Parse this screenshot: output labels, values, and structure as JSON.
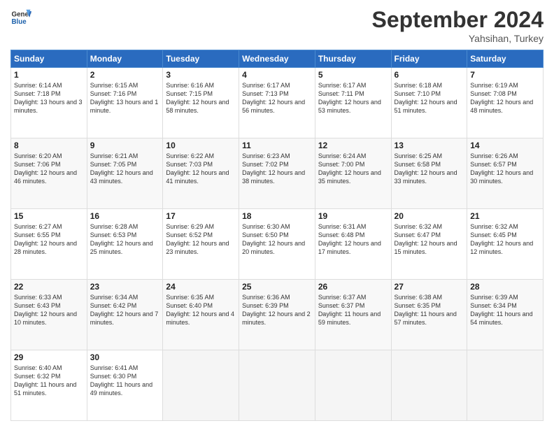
{
  "header": {
    "logo_line1": "General",
    "logo_line2": "Blue",
    "main_title": "September 2024",
    "subtitle": "Yahsihan, Turkey"
  },
  "weekdays": [
    "Sunday",
    "Monday",
    "Tuesday",
    "Wednesday",
    "Thursday",
    "Friday",
    "Saturday"
  ],
  "weeks": [
    [
      {
        "day": "1",
        "sunrise": "Sunrise: 6:14 AM",
        "sunset": "Sunset: 7:18 PM",
        "daylight": "Daylight: 13 hours and 3 minutes."
      },
      {
        "day": "2",
        "sunrise": "Sunrise: 6:15 AM",
        "sunset": "Sunset: 7:16 PM",
        "daylight": "Daylight: 13 hours and 1 minute."
      },
      {
        "day": "3",
        "sunrise": "Sunrise: 6:16 AM",
        "sunset": "Sunset: 7:15 PM",
        "daylight": "Daylight: 12 hours and 58 minutes."
      },
      {
        "day": "4",
        "sunrise": "Sunrise: 6:17 AM",
        "sunset": "Sunset: 7:13 PM",
        "daylight": "Daylight: 12 hours and 56 minutes."
      },
      {
        "day": "5",
        "sunrise": "Sunrise: 6:17 AM",
        "sunset": "Sunset: 7:11 PM",
        "daylight": "Daylight: 12 hours and 53 minutes."
      },
      {
        "day": "6",
        "sunrise": "Sunrise: 6:18 AM",
        "sunset": "Sunset: 7:10 PM",
        "daylight": "Daylight: 12 hours and 51 minutes."
      },
      {
        "day": "7",
        "sunrise": "Sunrise: 6:19 AM",
        "sunset": "Sunset: 7:08 PM",
        "daylight": "Daylight: 12 hours and 48 minutes."
      }
    ],
    [
      {
        "day": "8",
        "sunrise": "Sunrise: 6:20 AM",
        "sunset": "Sunset: 7:06 PM",
        "daylight": "Daylight: 12 hours and 46 minutes."
      },
      {
        "day": "9",
        "sunrise": "Sunrise: 6:21 AM",
        "sunset": "Sunset: 7:05 PM",
        "daylight": "Daylight: 12 hours and 43 minutes."
      },
      {
        "day": "10",
        "sunrise": "Sunrise: 6:22 AM",
        "sunset": "Sunset: 7:03 PM",
        "daylight": "Daylight: 12 hours and 41 minutes."
      },
      {
        "day": "11",
        "sunrise": "Sunrise: 6:23 AM",
        "sunset": "Sunset: 7:02 PM",
        "daylight": "Daylight: 12 hours and 38 minutes."
      },
      {
        "day": "12",
        "sunrise": "Sunrise: 6:24 AM",
        "sunset": "Sunset: 7:00 PM",
        "daylight": "Daylight: 12 hours and 35 minutes."
      },
      {
        "day": "13",
        "sunrise": "Sunrise: 6:25 AM",
        "sunset": "Sunset: 6:58 PM",
        "daylight": "Daylight: 12 hours and 33 minutes."
      },
      {
        "day": "14",
        "sunrise": "Sunrise: 6:26 AM",
        "sunset": "Sunset: 6:57 PM",
        "daylight": "Daylight: 12 hours and 30 minutes."
      }
    ],
    [
      {
        "day": "15",
        "sunrise": "Sunrise: 6:27 AM",
        "sunset": "Sunset: 6:55 PM",
        "daylight": "Daylight: 12 hours and 28 minutes."
      },
      {
        "day": "16",
        "sunrise": "Sunrise: 6:28 AM",
        "sunset": "Sunset: 6:53 PM",
        "daylight": "Daylight: 12 hours and 25 minutes."
      },
      {
        "day": "17",
        "sunrise": "Sunrise: 6:29 AM",
        "sunset": "Sunset: 6:52 PM",
        "daylight": "Daylight: 12 hours and 23 minutes."
      },
      {
        "day": "18",
        "sunrise": "Sunrise: 6:30 AM",
        "sunset": "Sunset: 6:50 PM",
        "daylight": "Daylight: 12 hours and 20 minutes."
      },
      {
        "day": "19",
        "sunrise": "Sunrise: 6:31 AM",
        "sunset": "Sunset: 6:48 PM",
        "daylight": "Daylight: 12 hours and 17 minutes."
      },
      {
        "day": "20",
        "sunrise": "Sunrise: 6:32 AM",
        "sunset": "Sunset: 6:47 PM",
        "daylight": "Daylight: 12 hours and 15 minutes."
      },
      {
        "day": "21",
        "sunrise": "Sunrise: 6:32 AM",
        "sunset": "Sunset: 6:45 PM",
        "daylight": "Daylight: 12 hours and 12 minutes."
      }
    ],
    [
      {
        "day": "22",
        "sunrise": "Sunrise: 6:33 AM",
        "sunset": "Sunset: 6:43 PM",
        "daylight": "Daylight: 12 hours and 10 minutes."
      },
      {
        "day": "23",
        "sunrise": "Sunrise: 6:34 AM",
        "sunset": "Sunset: 6:42 PM",
        "daylight": "Daylight: 12 hours and 7 minutes."
      },
      {
        "day": "24",
        "sunrise": "Sunrise: 6:35 AM",
        "sunset": "Sunset: 6:40 PM",
        "daylight": "Daylight: 12 hours and 4 minutes."
      },
      {
        "day": "25",
        "sunrise": "Sunrise: 6:36 AM",
        "sunset": "Sunset: 6:39 PM",
        "daylight": "Daylight: 12 hours and 2 minutes."
      },
      {
        "day": "26",
        "sunrise": "Sunrise: 6:37 AM",
        "sunset": "Sunset: 6:37 PM",
        "daylight": "Daylight: 11 hours and 59 minutes."
      },
      {
        "day": "27",
        "sunrise": "Sunrise: 6:38 AM",
        "sunset": "Sunset: 6:35 PM",
        "daylight": "Daylight: 11 hours and 57 minutes."
      },
      {
        "day": "28",
        "sunrise": "Sunrise: 6:39 AM",
        "sunset": "Sunset: 6:34 PM",
        "daylight": "Daylight: 11 hours and 54 minutes."
      }
    ],
    [
      {
        "day": "29",
        "sunrise": "Sunrise: 6:40 AM",
        "sunset": "Sunset: 6:32 PM",
        "daylight": "Daylight: 11 hours and 51 minutes."
      },
      {
        "day": "30",
        "sunrise": "Sunrise: 6:41 AM",
        "sunset": "Sunset: 6:30 PM",
        "daylight": "Daylight: 11 hours and 49 minutes."
      },
      {
        "day": "",
        "sunrise": "",
        "sunset": "",
        "daylight": ""
      },
      {
        "day": "",
        "sunrise": "",
        "sunset": "",
        "daylight": ""
      },
      {
        "day": "",
        "sunrise": "",
        "sunset": "",
        "daylight": ""
      },
      {
        "day": "",
        "sunrise": "",
        "sunset": "",
        "daylight": ""
      },
      {
        "day": "",
        "sunrise": "",
        "sunset": "",
        "daylight": ""
      }
    ]
  ]
}
